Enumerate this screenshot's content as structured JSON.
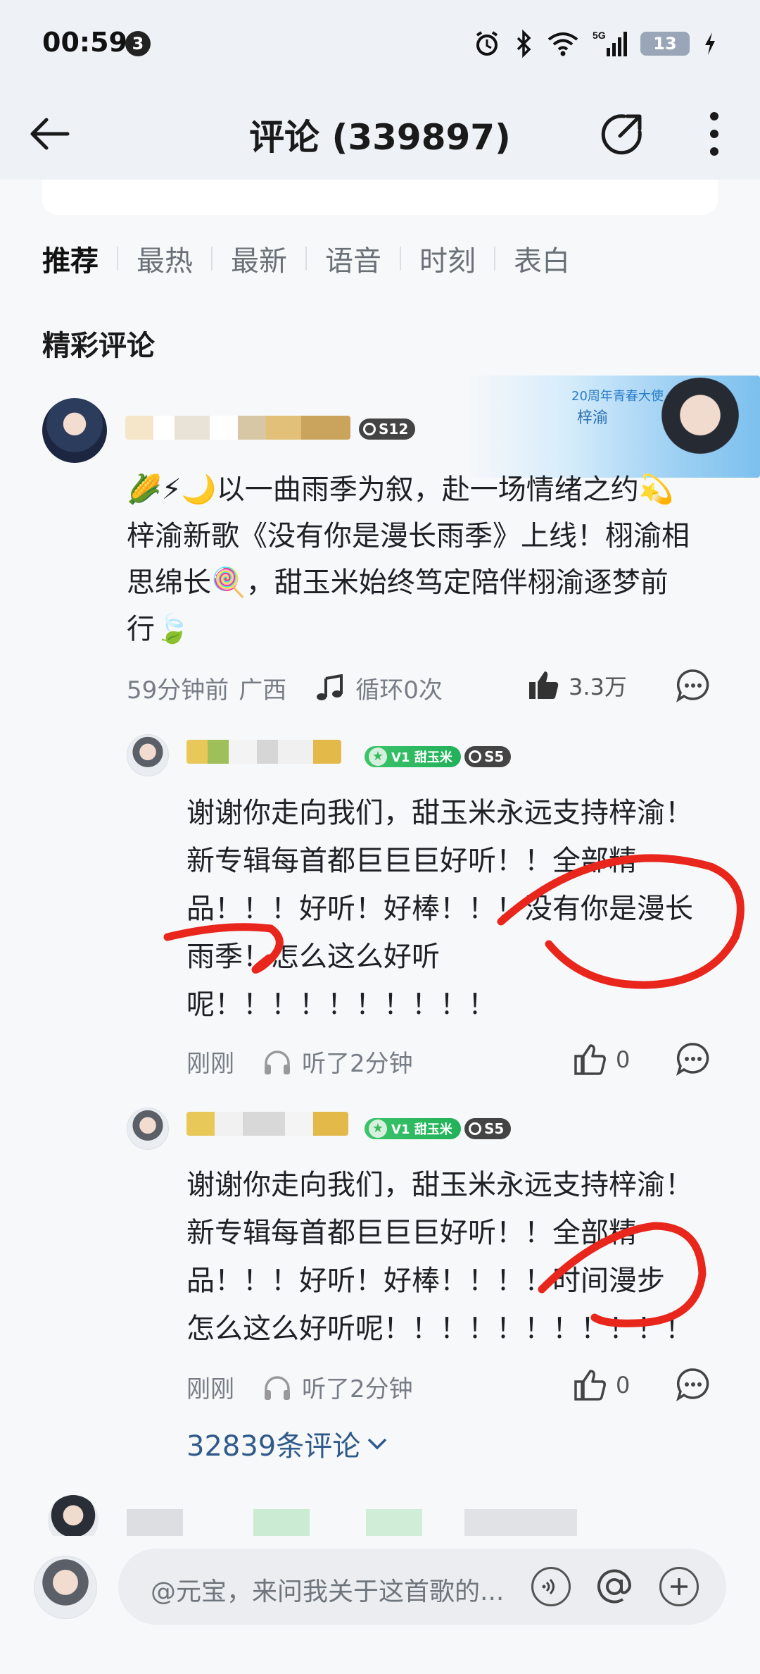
{
  "status_bar": {
    "time": "00:59",
    "notif_count": "3",
    "battery": "13",
    "network": "5G"
  },
  "header": {
    "title": "评论 (339897)"
  },
  "tabs": [
    {
      "label": "推荐",
      "active": true
    },
    {
      "label": "最热"
    },
    {
      "label": "最新"
    },
    {
      "label": "语音"
    },
    {
      "label": "时刻"
    },
    {
      "label": "表白"
    }
  ],
  "section_title": "精彩评论",
  "main_comment": {
    "level": "S12",
    "banner": {
      "tag": "20周年青春大使",
      "name": "梓渝"
    },
    "text_lines": [
      "🌽⚡🌙以一曲雨季为叙，赴一场情绪之约💫",
      "梓渝新歌《没有你是漫长雨季》上线！栩渝相",
      "思绵长🍭，甜玉米始终笃定陪伴栩渝逐梦前",
      "行🍃"
    ],
    "time": "59分钟前",
    "location": "广西",
    "loop": "循环0次",
    "likes": "3.3万"
  },
  "replies": [
    {
      "fan_badge": "V1 甜玉米",
      "level": "S5",
      "text_lines": [
        "谢谢你走向我们，甜玉米永远支持梓渝！",
        "新专辑每首都巨巨巨好听！！全部精",
        "品！！！好听！好棒！！！没有你是漫长",
        "雨季！怎么这么好听",
        "呢！！！！！！！！！！"
      ],
      "time": "刚刚",
      "listened": "听了2分钟",
      "likes": "0"
    },
    {
      "fan_badge": "V1 甜玉米",
      "level": "S5",
      "text_lines": [
        "谢谢你走向我们，甜玉米永远支持梓渝！",
        "新专辑每首都巨巨巨好听！！全部精",
        "品！！！好听！好棒！！！！时间漫步",
        "怎么这么好听呢！！！！！！！！！！！"
      ],
      "time": "刚刚",
      "listened": "听了2分钟",
      "likes": "0"
    }
  ],
  "more_replies": "32839条评论",
  "input": {
    "placeholder": "@元宝，来问我关于这首歌的..."
  },
  "colors": {
    "annotation": "#e8261c",
    "link": "#2f5a8a",
    "fan_badge": "#2fb95e"
  }
}
